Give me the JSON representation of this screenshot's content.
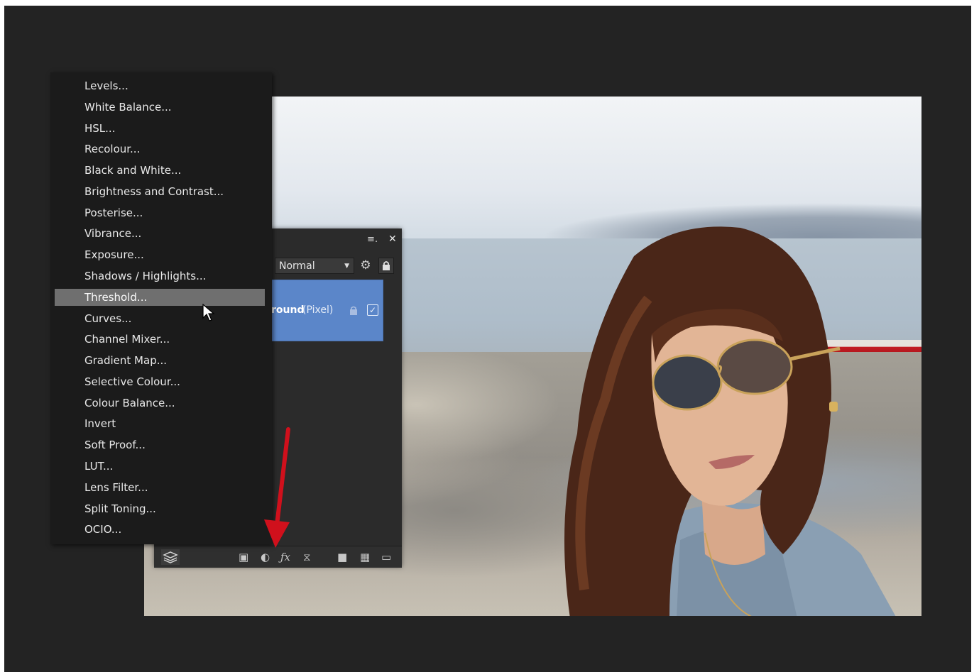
{
  "adjustment_menu": {
    "items": [
      {
        "label": "Levels..."
      },
      {
        "label": "White Balance..."
      },
      {
        "label": "HSL..."
      },
      {
        "label": "Recolour..."
      },
      {
        "label": "Black and White..."
      },
      {
        "label": "Brightness and Contrast..."
      },
      {
        "label": "Posterise..."
      },
      {
        "label": "Vibrance..."
      },
      {
        "label": "Exposure..."
      },
      {
        "label": "Shadows / Highlights..."
      },
      {
        "label": "Threshold..."
      },
      {
        "label": "Curves..."
      },
      {
        "label": "Channel Mixer..."
      },
      {
        "label": "Gradient Map..."
      },
      {
        "label": "Selective Colour..."
      },
      {
        "label": "Colour Balance..."
      },
      {
        "label": "Invert"
      },
      {
        "label": "Soft Proof..."
      },
      {
        "label": "LUT..."
      },
      {
        "label": "Lens Filter..."
      },
      {
        "label": "Split Toning..."
      },
      {
        "label": "OCIO..."
      }
    ],
    "highlighted": "Threshold..."
  },
  "layers_panel": {
    "blend_mode": "Normal",
    "layer": {
      "name": "round",
      "type": "(Pixel)"
    },
    "toolbar_icons": [
      "layers-stack-icon",
      "mask-icon",
      "adjustment-icon",
      "fx-icon",
      "live-filter-icon",
      "group-folder-icon",
      "pixel-layer-icon",
      "trash-icon"
    ]
  },
  "colors": {
    "menu_bg": "#1b1b1b",
    "highlight": "#6f6f6f",
    "layer_selected": "#5b86c9",
    "annotation_arrow": "#d0101c"
  }
}
